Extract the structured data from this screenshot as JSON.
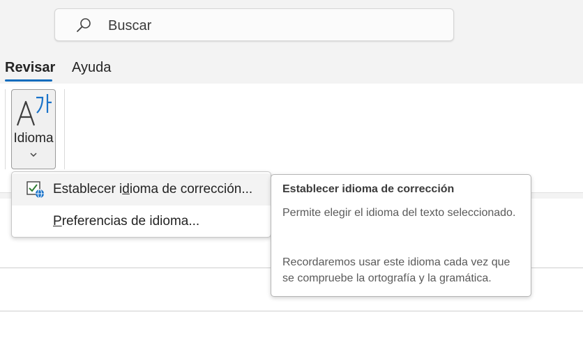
{
  "search": {
    "placeholder": "Buscar",
    "icon": "search-icon"
  },
  "tabs": [
    {
      "label": "Revisar",
      "active": true
    },
    {
      "label": "Ayuda",
      "active": false
    }
  ],
  "ribbon": {
    "language_button": {
      "label": "Idioma",
      "icon": "language-icon",
      "chevron": "chevron-down-icon"
    }
  },
  "menu": {
    "items": [
      {
        "label_pre": "Establecer i",
        "label_key": "d",
        "label_post": "ioma de corrección...",
        "icon": "proofing-language-icon",
        "highlighted": true
      },
      {
        "label_pre": "",
        "label_key": "P",
        "label_post": "referencias de idioma...",
        "icon": "",
        "highlighted": false
      }
    ]
  },
  "tooltip": {
    "title": "Establecer idioma de corrección",
    "paragraphs": [
      "Permite elegir el idioma del texto seleccionado.",
      "Recordaremos usar este idioma cada vez que se compruebe la ortografía y la gramática."
    ]
  },
  "colors": {
    "accent": "#0f6cbd",
    "globe_blue": "#1a73c9",
    "check_green": "#2e7d32"
  }
}
